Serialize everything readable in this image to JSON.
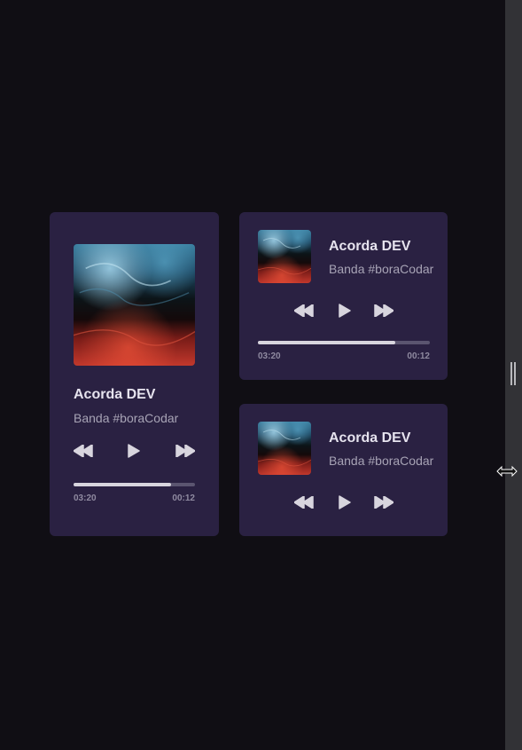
{
  "players": [
    {
      "variant": "large",
      "title": "Acorda DEV",
      "artist": "Banda #boraCodar",
      "controls": {
        "rewind_icon": "rewind-icon",
        "play_icon": "play-icon",
        "forward_icon": "fast-forward-icon"
      },
      "progress": {
        "elapsed": "03:20",
        "remaining": "00:12",
        "fraction": 0.8
      }
    },
    {
      "variant": "compact",
      "title": "Acorda DEV",
      "artist": "Banda #boraCodar",
      "controls": {
        "rewind_icon": "rewind-icon",
        "play_icon": "play-icon",
        "forward_icon": "fast-forward-icon"
      },
      "progress": {
        "elapsed": "03:20",
        "remaining": "00:12",
        "fraction": 0.8
      }
    },
    {
      "variant": "mini",
      "title": "Acorda DEV",
      "artist": "Banda #boraCodar",
      "controls": {
        "rewind_icon": "rewind-icon",
        "play_icon": "play-icon",
        "forward_icon": "fast-forward-icon"
      }
    }
  ],
  "colors": {
    "background": "#100e14",
    "card": "#2a2142",
    "title": "#e6e3ee",
    "artist": "#a7a3b5",
    "progress_fill": "#d8d5de",
    "progress_track": "#5b5570"
  }
}
